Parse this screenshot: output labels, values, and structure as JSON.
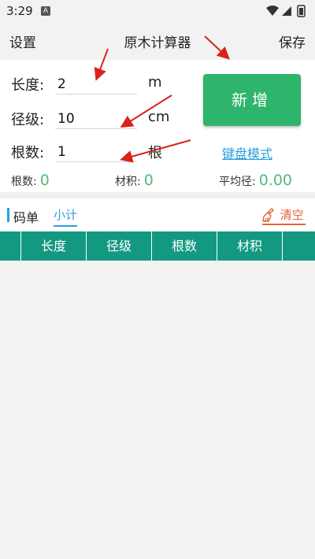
{
  "status": {
    "time": "3:29",
    "a_badge": "A"
  },
  "appbar": {
    "left": "设置",
    "title": "原木计算器",
    "right": "保存"
  },
  "form": {
    "length_label": "长度:",
    "length_value": "2",
    "length_unit": "m",
    "diameter_label": "径级:",
    "diameter_value": "10",
    "diameter_unit": "cm",
    "count_label": "根数:",
    "count_value": "1",
    "count_unit": "根",
    "add_button": "新增",
    "keyboard_mode": "键盘模式"
  },
  "stats": {
    "count_label": "根数:",
    "count_value": "0",
    "volume_label": "材积:",
    "volume_value": "0",
    "avg_label": "平均径:",
    "avg_value": "0.00"
  },
  "tabs": {
    "title": "码单",
    "subtotal": "小计",
    "clear": "清空"
  },
  "table": {
    "headers": [
      "",
      "长度",
      "径级",
      "根数",
      "材积",
      ""
    ]
  },
  "colors": {
    "accent_green": "#2fb56b",
    "table_teal": "#139981",
    "link_blue": "#2a9fd8",
    "clear_orange": "#e2653a",
    "arrow_red": "#d9221c"
  }
}
